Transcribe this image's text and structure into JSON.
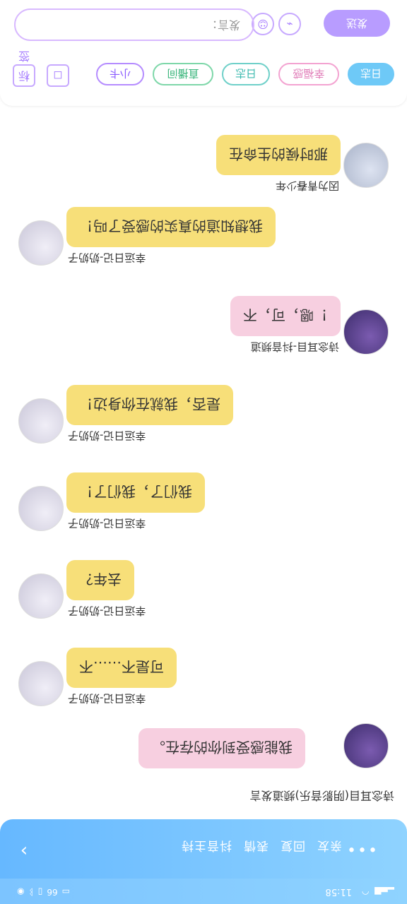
{
  "status_bar": {
    "time": "11:58",
    "left_icons": [
      "nfc-icon",
      "bluetooth-icon",
      "vibrate-icon",
      "battery-icon"
    ],
    "right_icons": [
      "signal-icon",
      "wifi-icon"
    ],
    "battery": "66"
  },
  "title_bar": {
    "back_icon": "chevron-left-icon",
    "more_icon": "more-dots-icon",
    "tabs": [
      "亲友",
      "回复",
      "表情",
      "抖音主持"
    ]
  },
  "room_line": "诗念耳目(阴影音乐)频道发言",
  "messages": [
    {
      "side": "left",
      "bubble_color": "pink",
      "text": "我能感受到你的存在。",
      "nick": "诗念耳目-抖音频道",
      "avatar": "avatar-purple-hair"
    },
    {
      "side": "right",
      "bubble_color": "yellow",
      "text": "可是不……不",
      "nick": "幸运日记-奶奶子",
      "avatar": "avatar-white-hair"
    },
    {
      "side": "right",
      "bubble_color": "yellow",
      "text": "去年？",
      "nick": "幸运日记-奶奶子",
      "avatar": "avatar-white-hair"
    },
    {
      "side": "right",
      "bubble_color": "yellow",
      "text": "我们了，我们了！",
      "nick": "幸运日记-奶奶子",
      "avatar": "avatar-white-hair"
    },
    {
      "side": "right",
      "bubble_color": "yellow",
      "text": "是否，我就在你身边！",
      "nick": "幸运日记-奶奶子",
      "avatar": "avatar-white-hair"
    },
    {
      "side": "left",
      "bubble_color": "pink",
      "text": "！嗯，可，不",
      "nick": "诗念耳目-抖音频道",
      "avatar": "avatar-purple-hair"
    },
    {
      "side": "right",
      "bubble_color": "yellow",
      "text": "我想知道的真实的感受了吗！",
      "nick": "幸运日记-奶奶子",
      "avatar": "avatar-white-hair"
    },
    {
      "side": "left",
      "bubble_color": "yellow",
      "text": "那时候的生命在",
      "nick": "因为青春少年",
      "avatar": "avatar-silver-hair"
    }
  ],
  "toolbar": {
    "chips": [
      {
        "label": "日志",
        "style": "filled-blue"
      },
      {
        "label": "幸福感",
        "style": "pink"
      },
      {
        "label": "日志",
        "style": "teal"
      },
      {
        "label": "直播间",
        "style": "green"
      },
      {
        "label": "小卡",
        "style": "purple"
      }
    ],
    "icon_buttons": [
      "capsule-icon",
      "tag-icon"
    ],
    "tag_label": "标签"
  },
  "input": {
    "placeholder": "发言：",
    "send_label": "发送",
    "emoji_icon": "smile-icon",
    "image_icon": "image-icon"
  }
}
